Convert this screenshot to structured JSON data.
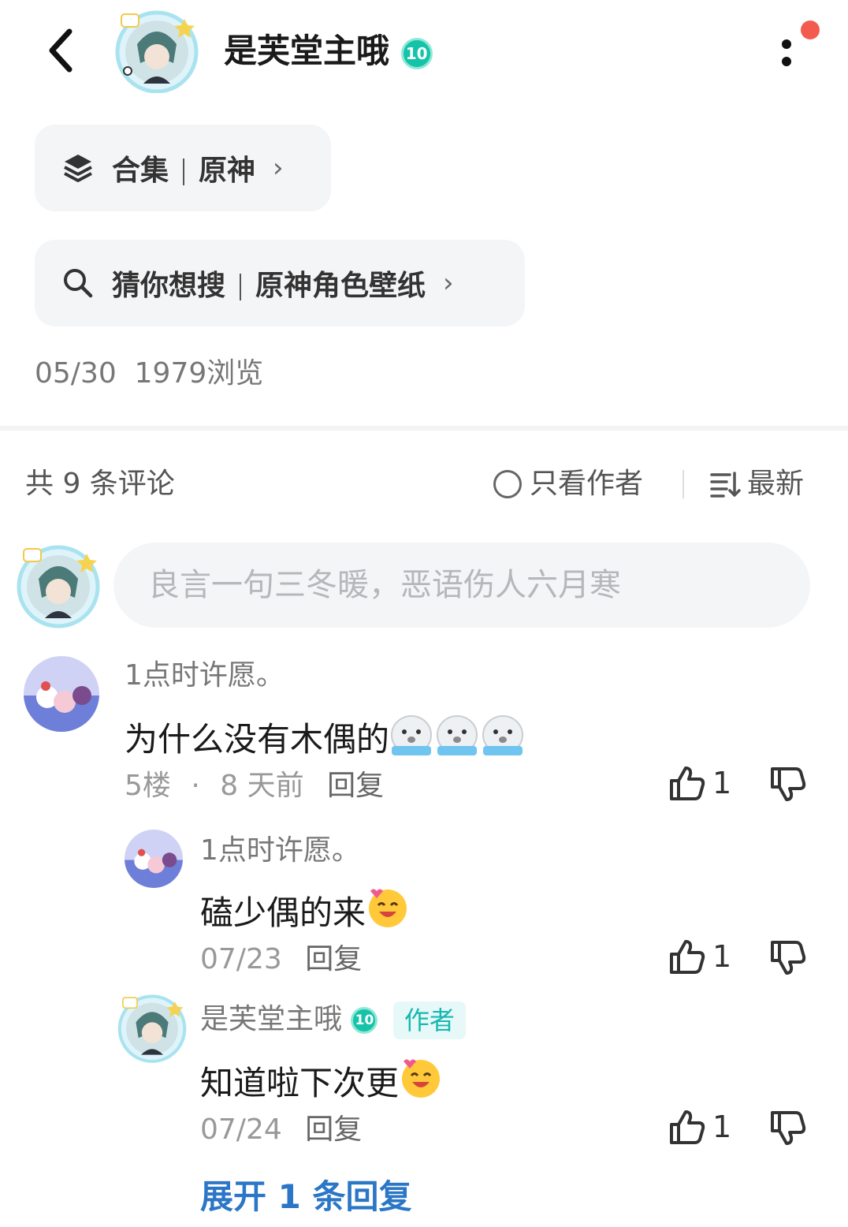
{
  "header": {
    "author_name": "是芙堂主哦",
    "level": "10"
  },
  "chips": {
    "collection_prefix": "合集",
    "collection_name": "原神",
    "search_prefix": "猜你想搜",
    "search_term": "原神角色壁纸"
  },
  "post_meta": {
    "date": "05/30",
    "views": "1979浏览"
  },
  "comments_header": {
    "count_label": "共 9 条评论",
    "only_author_label": "只看作者",
    "sort_label": "最新"
  },
  "input": {
    "placeholder": "良言一句三冬暖，恶语伤人六月寒"
  },
  "comments": [
    {
      "user": "1点时许愿。",
      "text": "为什么没有木偶的",
      "floor": "5楼",
      "time": "8 天前",
      "reply_label": "回复",
      "likes": "1"
    }
  ],
  "replies": [
    {
      "user": "1点时许愿。",
      "text": "磕少偶的来",
      "date": "07/23",
      "reply_label": "回复",
      "likes": "1"
    },
    {
      "user": "是芙堂主哦",
      "level": "10",
      "tag": "作者",
      "text": "知道啦下次更",
      "date": "07/24",
      "reply_label": "回复",
      "likes": "1"
    }
  ],
  "expand_label": "展开 1 条回复",
  "colors": {
    "accent_teal": "#14c3a8",
    "link_blue": "#2b76c6",
    "notif_red": "#f45b4f",
    "chip_bg": "#f4f5f7"
  }
}
